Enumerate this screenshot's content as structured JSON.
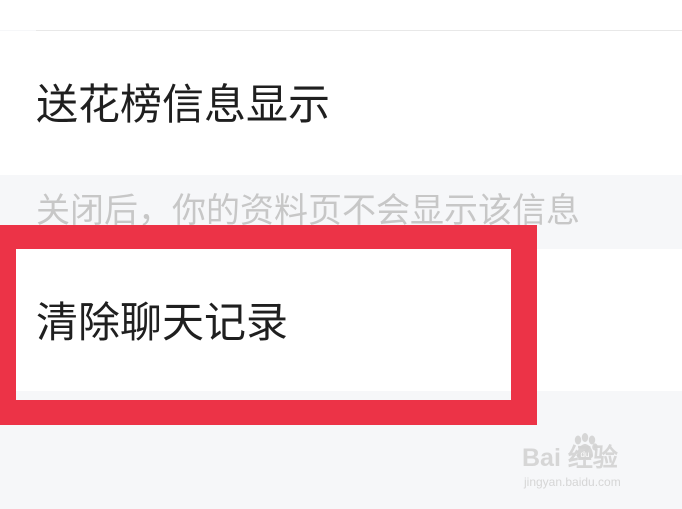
{
  "settings": {
    "flower_ranking": {
      "title": "送花榜信息显示",
      "hint": "关闭后，你的资料页不会显示该信息"
    },
    "clear_chat": {
      "title": "清除聊天记录"
    }
  },
  "annotation": {
    "highlight_color": "#ec3347"
  },
  "watermark": {
    "brand": "Bai  经验",
    "url": "jingyan.baidu.com"
  }
}
